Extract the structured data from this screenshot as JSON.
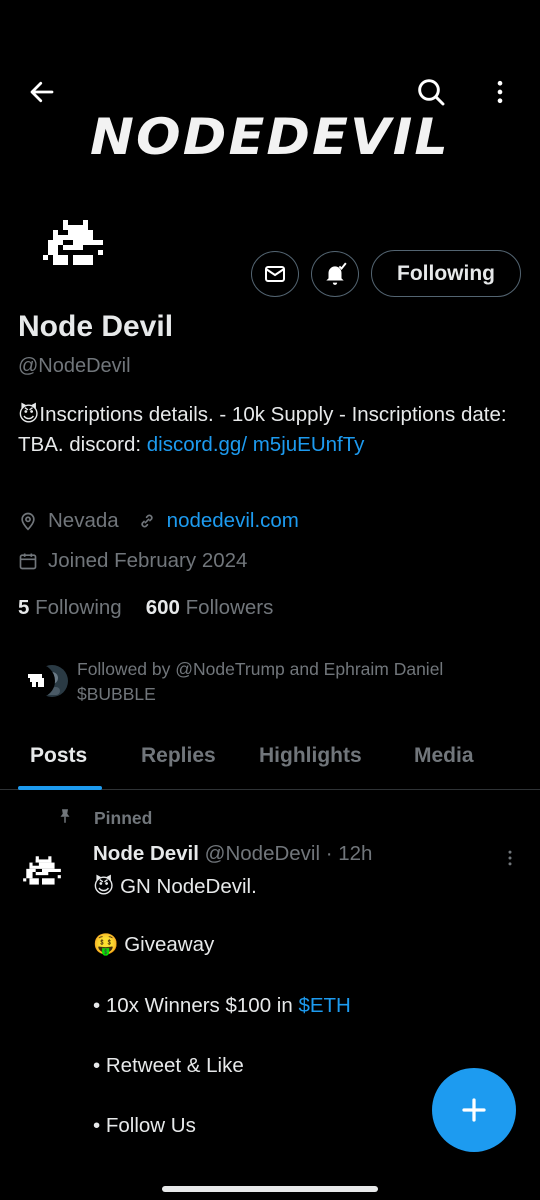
{
  "banner": {
    "logo_text": "NODEDEVIL"
  },
  "header": {
    "back_icon": "arrow-left-icon",
    "search_icon": "search-icon",
    "more_icon": "more-vertical-icon"
  },
  "profile": {
    "name": "Node Devil",
    "handle": "@NodeDevil",
    "bio_emoji": "😈",
    "bio_text": "Inscriptions details. - 10k Supply - Inscriptions date: TBA. discord: ",
    "bio_link": "discord.gg/ m5juEUnfTy",
    "location": "Nevada",
    "website": "nodedevil.com",
    "joined": "Joined February 2024",
    "following_count": "5",
    "following_label": "Following",
    "followers_count": "600",
    "followers_label": "Followers",
    "followed_by_line1": "Followed by @NodeTrump and Ephraim Daniel",
    "followed_by_line2": "$BUBBLE"
  },
  "actions": {
    "message_icon": "mail-icon",
    "notify_icon": "bell-icon",
    "follow_label": "Following"
  },
  "tabs": [
    {
      "label": "Posts",
      "active": true
    },
    {
      "label": "Replies",
      "active": false
    },
    {
      "label": "Highlights",
      "active": false
    },
    {
      "label": "Media",
      "active": false
    }
  ],
  "post": {
    "pinned_label": "Pinned",
    "author_name": "Node Devil",
    "author_handle": "@NodeDevil · 12h",
    "line1_emoji": "😈",
    "line1_text": " GN NodeDevil.",
    "line2_emoji": "🤑",
    "line2_text": " Giveaway",
    "line3_text": "• 10x  Winners $100 in ",
    "line3_link": "$ETH",
    "line4_text": "• Retweet & Like",
    "line5_text": "• Follow Us"
  },
  "fab": {
    "icon": "plus-icon"
  },
  "colors": {
    "accent": "#1d9bf0",
    "background": "#000000",
    "muted": "#71767b",
    "text": "#e7e9ea"
  }
}
